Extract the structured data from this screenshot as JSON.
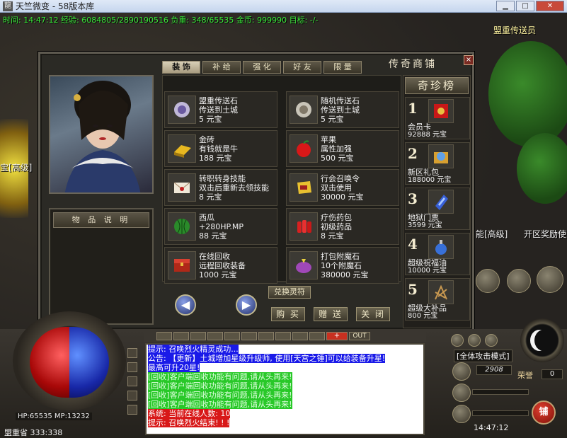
{
  "window": {
    "app_icon": "龍",
    "title": "天竺微变 - 58版本库",
    "min": "▁",
    "max": "□",
    "close": "✕"
  },
  "status_line": "时间: 14:47:12 经验: 6084805/2890190516 负重: 348/65535 金币: 999990 目标: -/-",
  "world_labels": {
    "npc_top": "盟重传送员",
    "left": "宝[高级]",
    "right_1": "能[高级]",
    "right_2": "开区奖励使"
  },
  "shop": {
    "title": "传奇商铺",
    "close": "×",
    "tabs": [
      "装 饰",
      "补 给",
      "强 化",
      "好 友",
      "限 量"
    ],
    "desc_title": "物 品 说 明",
    "items": [
      {
        "name": "盟重传送石",
        "line2": "传送到土城",
        "price": "5 元宝",
        "icon": "teleport-stone-icon"
      },
      {
        "name": "随机传送石",
        "line2": "传送到土城",
        "price": "5 元宝",
        "icon": "random-stone-icon"
      },
      {
        "name": "金砖",
        "line2": "有钱就是牛",
        "price": "188 元宝",
        "icon": "gold-brick-icon"
      },
      {
        "name": "苹果",
        "line2": "属性加强",
        "price": "500 元宝",
        "icon": "apple-icon"
      },
      {
        "name": "转职转身技能",
        "line2": "双击后重新去领技能",
        "price": "8 元宝",
        "icon": "letter-icon"
      },
      {
        "name": "行会召唤令",
        "line2": "双击使用",
        "price": "30000 元宝",
        "icon": "summon-token-icon"
      },
      {
        "name": "西瓜",
        "line2": "+280HP.MP",
        "price": "88 元宝",
        "icon": "watermelon-icon"
      },
      {
        "name": "疗伤药包",
        "line2": "初级药品",
        "price": "8 元宝",
        "icon": "potion-pack-icon"
      },
      {
        "name": "在线回收",
        "line2": "远程回收装备",
        "price": "1000 元宝",
        "icon": "chest-icon"
      },
      {
        "name": "打包附魔石",
        "line2": "10个附魔石",
        "price": "380000 元宝",
        "icon": "gem-bag-icon"
      }
    ],
    "exchange": "兑换灵符",
    "prev": "◀",
    "next": "▶",
    "buy": "购 买",
    "gift": "赠 送",
    "close_btn": "关 闭",
    "treasure": {
      "title": "奇珍榜",
      "entries": [
        {
          "rank": "1",
          "name": "会员卡",
          "price": "92888 元宝",
          "icon": "vip-card-icon"
        },
        {
          "rank": "2",
          "name": "新区礼包",
          "price": "188000 元宝",
          "icon": "gift-pack-icon"
        },
        {
          "rank": "3",
          "name": "地狱门票",
          "price": "3599 元宝",
          "icon": "ticket-icon"
        },
        {
          "rank": "4",
          "name": "超级祝福油",
          "price": "10000 元宝",
          "icon": "blessing-oil-icon"
        },
        {
          "rank": "5",
          "name": "超级大补品",
          "price": "800 元宝",
          "icon": "tonic-icon"
        }
      ]
    }
  },
  "hud": {
    "hp_mp": "HP:65535   MP:13232",
    "location": "盟重省  333:338",
    "attack_mode": "[全体攻击模式]",
    "level": "2908",
    "honor_label": "荣誉",
    "honor_value": "0",
    "clock": "14:47:12",
    "shop_btn": "铺",
    "chat_out": "OUT",
    "chat_plus": "+"
  },
  "chat": [
    {
      "text": "提示: 召唤烈火精灵成功...",
      "color": "#ffffff",
      "bg": "#1a1ae8"
    },
    {
      "text": "公告: 【更新】土城增加星级升级师, 使用[天宫之锤]可以给装备升星!",
      "color": "#ffffff",
      "bg": "#1a1ae8"
    },
    {
      "text": "最高可升20星!",
      "color": "#ffffff",
      "bg": "#1a1ae8"
    },
    {
      "text": "[回收]客户端回收功能有问题,请从头再来!",
      "color": "#e0ffe0",
      "bg": "#28c828"
    },
    {
      "text": "[回收]客户端回收功能有问题,请从头再来!",
      "color": "#e0ffe0",
      "bg": "#28c828"
    },
    {
      "text": "[回收]客户端回收功能有问题,请从头再来!",
      "color": "#e0ffe0",
      "bg": "#28c828"
    },
    {
      "text": "[回收]客户端回收功能有问题,请从头再来!",
      "color": "#e0ffe0",
      "bg": "#28c828"
    },
    {
      "text": "系统: 当前在线人数: 10",
      "color": "#ffffff",
      "bg": "#d81818"
    },
    {
      "text": "提示: 召唤烈火结束! ! !",
      "color": "#ffffff",
      "bg": "#d81818"
    }
  ]
}
